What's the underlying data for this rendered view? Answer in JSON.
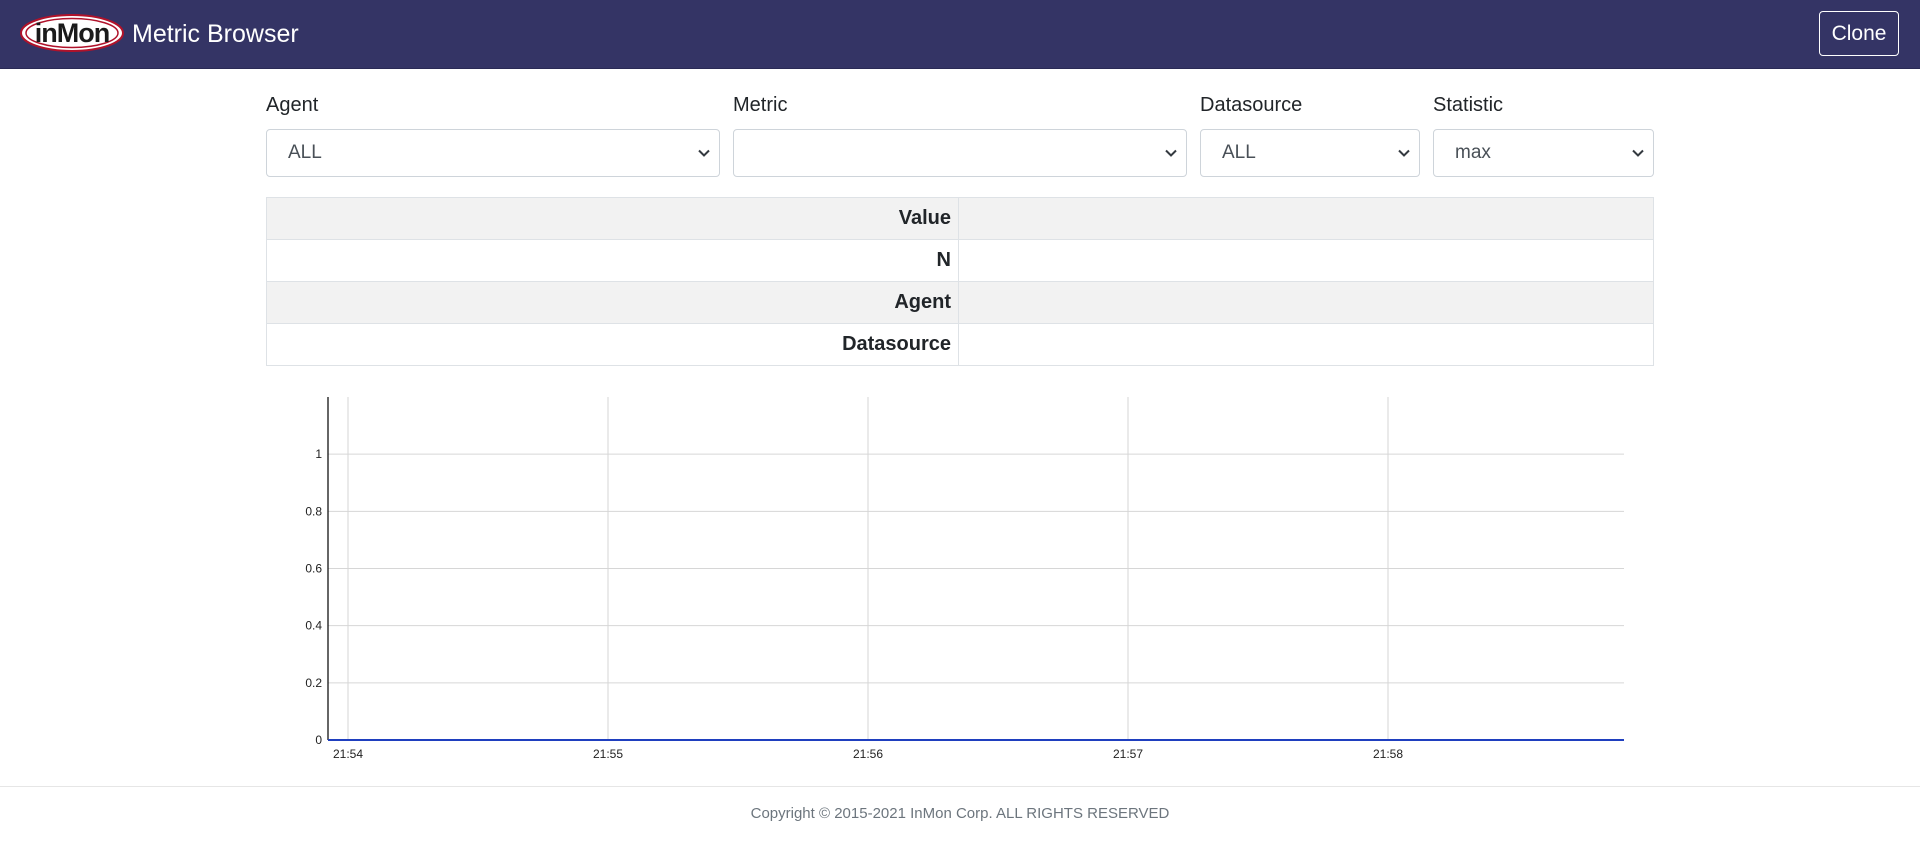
{
  "header": {
    "logo_text": "inMon",
    "title": "Metric Browser",
    "clone_label": "Clone"
  },
  "controls": {
    "agent": {
      "label": "Agent",
      "value": "ALL"
    },
    "metric": {
      "label": "Metric",
      "value": ""
    },
    "datasource": {
      "label": "Datasource",
      "value": "ALL"
    },
    "statistic": {
      "label": "Statistic",
      "value": "max"
    }
  },
  "info_table": {
    "rows": [
      {
        "key": "Value",
        "value": ""
      },
      {
        "key": "N",
        "value": ""
      },
      {
        "key": "Agent",
        "value": ""
      },
      {
        "key": "Datasource",
        "value": ""
      }
    ]
  },
  "chart_data": {
    "type": "line",
    "x_ticks": [
      "21:54",
      "21:55",
      "21:56",
      "21:57",
      "21:58"
    ],
    "y_ticks": [
      "0",
      "0.2",
      "0.4",
      "0.6",
      "0.8",
      "1"
    ],
    "ylim": [
      0,
      1.2
    ],
    "grid": true,
    "series": [
      {
        "values": [
          0,
          0,
          0,
          0,
          0,
          0
        ],
        "color": "#1f3fbf"
      }
    ]
  },
  "footer": {
    "copyright": "Copyright © 2015-2021 InMon Corp. ALL RIGHTS RESERVED"
  },
  "colors": {
    "navbar": "#343465",
    "logo_red": "#b0122a",
    "series_line": "#1f3fbf"
  }
}
